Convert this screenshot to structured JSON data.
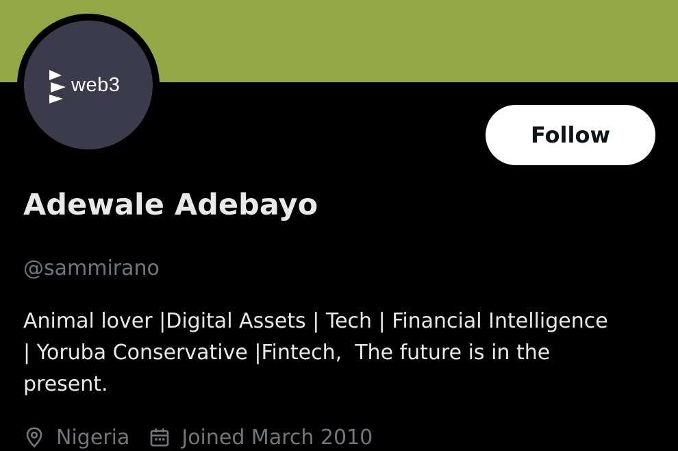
{
  "profile": {
    "banner_color": "#93a845",
    "avatar": {
      "brand_text": "web3",
      "background": "#3c3b4b"
    },
    "follow_label": "Follow",
    "display_name": "Adewale Adebayo",
    "handle": "@sammirano",
    "bio_lines": [
      "Animal lover |Digital Assets | Tech | Financial Intelligence",
      "| Yoruba Conservative |Fintech,  The future is in the",
      "present."
    ],
    "location": {
      "icon": "location-pin-icon",
      "text": "Nigeria"
    },
    "joined": {
      "icon": "calendar-icon",
      "text": "Joined March 2010"
    }
  }
}
